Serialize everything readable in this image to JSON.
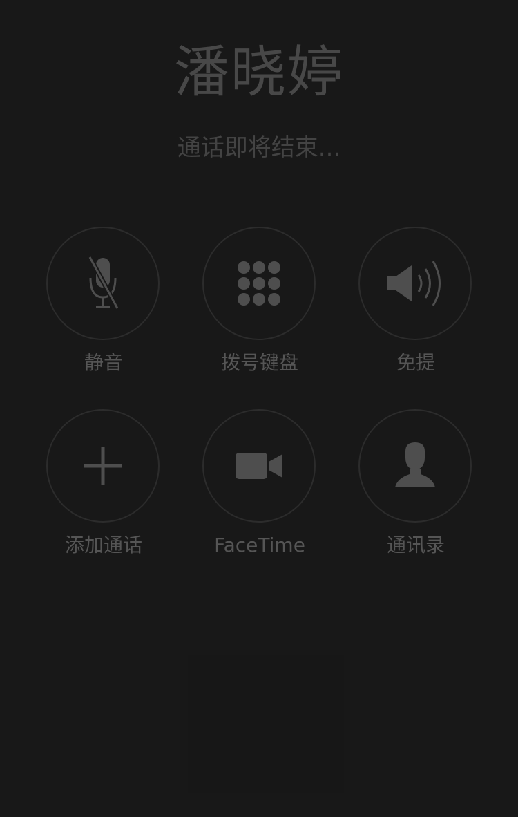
{
  "call": {
    "name": "潘晓婷",
    "status": "通话即将结束..."
  },
  "controls": {
    "mute": {
      "label": "静音",
      "icon": "muted-microphone-icon"
    },
    "keypad": {
      "label": "拨号键盘",
      "icon": "keypad-icon"
    },
    "speaker": {
      "label": "免提",
      "icon": "speaker-icon"
    },
    "add_call": {
      "label": "添加通话",
      "icon": "plus-icon"
    },
    "facetime": {
      "label": "FaceTime",
      "icon": "video-camera-icon"
    },
    "contacts": {
      "label": "通讯录",
      "icon": "contact-person-icon"
    }
  },
  "colors": {
    "background": "#181818",
    "ring": "#2c2c2c",
    "icon": "#4e4e4e",
    "text": "#555555"
  }
}
